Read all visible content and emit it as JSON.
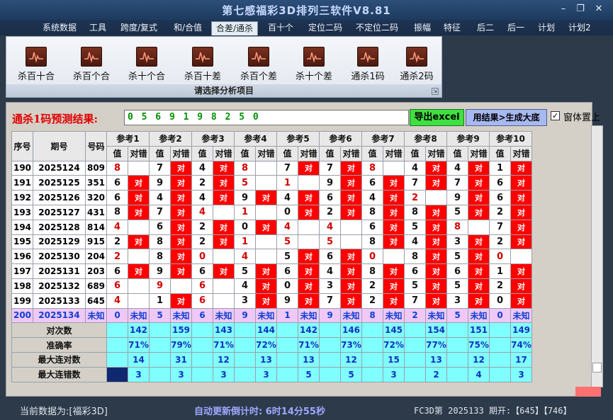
{
  "window": {
    "title": "第七感福彩3D排列三软件V8.81",
    "minimize": "–",
    "restore": "❐",
    "close": "✕"
  },
  "menu": [
    "系统数据",
    "工具",
    "跨度/复式",
    "和/合值",
    "合差/通杀",
    "百十个",
    "定位二码",
    "不定位二码",
    "振幅",
    "特征",
    "后二",
    "后一",
    "计划",
    "计划2"
  ],
  "menu_active_index": 4,
  "ribbon": {
    "buttons": [
      "杀百十合",
      "杀百个合",
      "杀十个合",
      "杀百十差",
      "杀百个差",
      "杀十个差",
      "通杀1码",
      "通杀2码"
    ],
    "caption": "请选择分析项目",
    "corner": "⇲"
  },
  "predict": {
    "label": "通杀1码预测结果:",
    "value": "0 5 6 9 1 9 8 2 5 0",
    "export_button": "导出excel",
    "generate_button": "用结果>生成大底",
    "pin_label": "窗体置上",
    "pin_checked": "✓"
  },
  "table": {
    "headers": {
      "seq": "序号",
      "period": "期号",
      "number": "号码",
      "refs": [
        "参考1",
        "参考2",
        "参考3",
        "参考4",
        "参考5",
        "参考6",
        "参考7",
        "参考8",
        "参考9",
        "参考10"
      ],
      "value": "值",
      "result": "对错"
    },
    "hit_text": "对",
    "rows": [
      {
        "seq": "190",
        "period": "2025124",
        "number": "809",
        "cells": [
          [
            "8",
            "red",
            0
          ],
          [
            "7",
            "black",
            1
          ],
          [
            "4",
            "black",
            1
          ],
          [
            "8",
            "red",
            0
          ],
          [
            "7",
            "black",
            1
          ],
          [
            "7",
            "black",
            1
          ],
          [
            "8",
            "red",
            0
          ],
          [
            "4",
            "black",
            1
          ],
          [
            "4",
            "black",
            1
          ],
          [
            "1",
            "black",
            1
          ]
        ]
      },
      {
        "seq": "191",
        "period": "2025125",
        "number": "351",
        "cells": [
          [
            "6",
            "black",
            1
          ],
          [
            "9",
            "black",
            1
          ],
          [
            "2",
            "black",
            1
          ],
          [
            "5",
            "red",
            0
          ],
          [
            "1",
            "red",
            0
          ],
          [
            "9",
            "black",
            1
          ],
          [
            "6",
            "black",
            1
          ],
          [
            "7",
            "black",
            1
          ],
          [
            "7",
            "black",
            1
          ],
          [
            "6",
            "black",
            1
          ]
        ]
      },
      {
        "seq": "192",
        "period": "2025126",
        "number": "320",
        "cells": [
          [
            "6",
            "black",
            1
          ],
          [
            "4",
            "black",
            1
          ],
          [
            "4",
            "black",
            1
          ],
          [
            "9",
            "black",
            1
          ],
          [
            "4",
            "black",
            1
          ],
          [
            "6",
            "black",
            1
          ],
          [
            "4",
            "black",
            1
          ],
          [
            "2",
            "red",
            0
          ],
          [
            "9",
            "black",
            1
          ],
          [
            "6",
            "black",
            1
          ]
        ]
      },
      {
        "seq": "193",
        "period": "2025127",
        "number": "431",
        "cells": [
          [
            "8",
            "black",
            1
          ],
          [
            "7",
            "black",
            1
          ],
          [
            "4",
            "red",
            0
          ],
          [
            "1",
            "red",
            0
          ],
          [
            "0",
            "black",
            1
          ],
          [
            "2",
            "black",
            1
          ],
          [
            "8",
            "black",
            1
          ],
          [
            "8",
            "black",
            1
          ],
          [
            "5",
            "black",
            1
          ],
          [
            "2",
            "black",
            1
          ]
        ]
      },
      {
        "seq": "194",
        "period": "2025128",
        "number": "814",
        "cells": [
          [
            "4",
            "red",
            0
          ],
          [
            "6",
            "black",
            1
          ],
          [
            "2",
            "black",
            1
          ],
          [
            "0",
            "black",
            1
          ],
          [
            "4",
            "red",
            0
          ],
          [
            "4",
            "red",
            0
          ],
          [
            "6",
            "black",
            1
          ],
          [
            "5",
            "black",
            1
          ],
          [
            "8",
            "red",
            0
          ],
          [
            "7",
            "black",
            1
          ]
        ]
      },
      {
        "seq": "195",
        "period": "2025129",
        "number": "915",
        "cells": [
          [
            "2",
            "black",
            1
          ],
          [
            "8",
            "black",
            1
          ],
          [
            "2",
            "black",
            1
          ],
          [
            "1",
            "red",
            0
          ],
          [
            "5",
            "red",
            0
          ],
          [
            "5",
            "red",
            0
          ],
          [
            "8",
            "black",
            1
          ],
          [
            "4",
            "black",
            1
          ],
          [
            "3",
            "black",
            1
          ],
          [
            "2",
            "black",
            1
          ]
        ]
      },
      {
        "seq": "196",
        "period": "2025130",
        "number": "204",
        "cells": [
          [
            "2",
            "red",
            0
          ],
          [
            "8",
            "black",
            1
          ],
          [
            "0",
            "red",
            0
          ],
          [
            "4",
            "red",
            0
          ],
          [
            "5",
            "black",
            1
          ],
          [
            "6",
            "black",
            1
          ],
          [
            "0",
            "red",
            0
          ],
          [
            "8",
            "black",
            1
          ],
          [
            "5",
            "black",
            1
          ],
          [
            "0",
            "red",
            0
          ]
        ]
      },
      {
        "seq": "197",
        "period": "2025131",
        "number": "203",
        "cells": [
          [
            "6",
            "black",
            1
          ],
          [
            "9",
            "black",
            1
          ],
          [
            "6",
            "black",
            1
          ],
          [
            "5",
            "black",
            1
          ],
          [
            "6",
            "black",
            1
          ],
          [
            "4",
            "black",
            1
          ],
          [
            "8",
            "black",
            1
          ],
          [
            "6",
            "black",
            1
          ],
          [
            "6",
            "black",
            1
          ],
          [
            "1",
            "black",
            1
          ]
        ]
      },
      {
        "seq": "198",
        "period": "2025132",
        "number": "689",
        "cells": [
          [
            "6",
            "red",
            0
          ],
          [
            "9",
            "red",
            0
          ],
          [
            "6",
            "red",
            0
          ],
          [
            "4",
            "black",
            1
          ],
          [
            "0",
            "black",
            1
          ],
          [
            "3",
            "black",
            1
          ],
          [
            "2",
            "black",
            1
          ],
          [
            "5",
            "black",
            1
          ],
          [
            "5",
            "black",
            1
          ],
          [
            "2",
            "black",
            1
          ]
        ]
      },
      {
        "seq": "199",
        "period": "2025133",
        "number": "645",
        "cells": [
          [
            "4",
            "red",
            0
          ],
          [
            "1",
            "black",
            1
          ],
          [
            "6",
            "red",
            0
          ],
          [
            "3",
            "black",
            1
          ],
          [
            "9",
            "black",
            1
          ],
          [
            "7",
            "black",
            1
          ],
          [
            "2",
            "black",
            1
          ],
          [
            "7",
            "black",
            1
          ],
          [
            "3",
            "black",
            1
          ],
          [
            "0",
            "black",
            1
          ]
        ]
      }
    ],
    "future_row": {
      "seq": "200",
      "period": "2025134",
      "number": "未知",
      "values": [
        "0",
        "5",
        "6",
        "9",
        "1",
        "9",
        "8",
        "2",
        "5",
        "0"
      ],
      "unknown": "未知"
    },
    "stats": [
      {
        "label": "对次数",
        "values": [
          "142",
          "159",
          "143",
          "144",
          "142",
          "146",
          "145",
          "154",
          "151",
          "149"
        ]
      },
      {
        "label": "准确率",
        "values": [
          "71%",
          "79%",
          "71%",
          "72%",
          "71%",
          "73%",
          "72%",
          "77%",
          "75%",
          "74%"
        ]
      },
      {
        "label": "最大连对数",
        "values": [
          "14",
          "31",
          "12",
          "13",
          "13",
          "12",
          "15",
          "13",
          "12",
          "17"
        ]
      },
      {
        "label": "最大连错数",
        "values": [
          "3",
          "3",
          "3",
          "3",
          "5",
          "5",
          "3",
          "2",
          "4",
          "3"
        ]
      }
    ]
  },
  "status": {
    "data_source": "当前数据为:[福彩3D]",
    "countdown_label": "自动更新倒计时:",
    "countdown_value": "6时14分55秒",
    "period_info": "FC3D第 2025133 期开:【645】【746】"
  }
}
